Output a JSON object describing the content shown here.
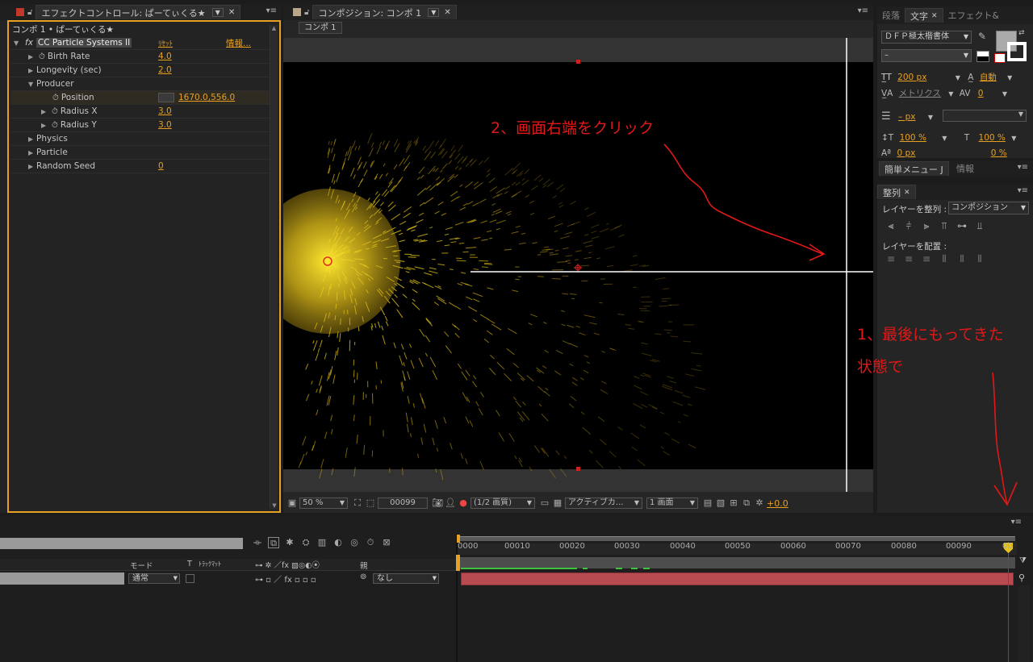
{
  "effect_panel": {
    "tab_title": "エフェクトコントロール: ぱーてぃくる★",
    "breadcrumb": "コンポ 1 • ぱーてぃくる★",
    "effect_name": "CC Particle Systems II",
    "reset_label": "ﾘｾｯﾄ",
    "info_label": "情報...",
    "properties": [
      {
        "name": "Birth Rate",
        "value": "4.0"
      },
      {
        "name": "Longevity (sec)",
        "value": "2.0"
      },
      {
        "name": "Producer",
        "value": ""
      },
      {
        "name": "Position",
        "value": "1670.0,556.0"
      },
      {
        "name": "Radius X",
        "value": "3.0"
      },
      {
        "name": "Radius Y",
        "value": "3.0"
      },
      {
        "name": "Physics",
        "value": ""
      },
      {
        "name": "Particle",
        "value": ""
      },
      {
        "name": "Random Seed",
        "value": "0"
      }
    ]
  },
  "comp_panel": {
    "tab_title": "コンポジション: コンポ 1",
    "comp_tab": "コンポ 1",
    "zoom": "50 %",
    "timecode": "00099",
    "resolution": "(1/2 画質)",
    "camera": "アクティブカ...",
    "views": "1 画面",
    "exposure": "+0.0"
  },
  "char_panel": {
    "tabs": [
      "段落",
      "文字",
      "エフェクト&"
    ],
    "font": "ＤＦＰ極太楷書体",
    "style": "–",
    "size": "200 px",
    "leading": "自動",
    "kerning": "メトリクス",
    "tracking": "0",
    "line_unit": "– px",
    "vscale": "100 %",
    "hscale": "100 %",
    "baseline": "0 px",
    "tsume": "0 %"
  },
  "mini_panel": {
    "tabs": [
      "簡単メニュー J",
      "情報"
    ]
  },
  "align_panel": {
    "tab": "整列",
    "align_to_label": "レイヤーを整列 :",
    "align_to_value": "コンポジション",
    "distribute_label": "レイヤーを配置 :"
  },
  "timeline": {
    "columns": {
      "mode": "モード",
      "t": "T",
      "trkmat": "ﾄﾗｯｸﾏｯﾄ",
      "parent": "親"
    },
    "layer": {
      "mode": "通常",
      "parent": "なし"
    },
    "ticks": [
      "0000",
      "00010",
      "00020",
      "00030",
      "00040",
      "00050",
      "00060",
      "00070",
      "00080",
      "00090",
      "00"
    ]
  },
  "annotations": {
    "step1_line1": "1、最後にもってきた",
    "step1_line2": "状態で",
    "step2": "2、画面右端をクリック"
  },
  "colors": {
    "accent": "#e6a024",
    "annotation": "#e01818",
    "layer_bar": "#b84a52",
    "particles": "#e6c21c"
  }
}
